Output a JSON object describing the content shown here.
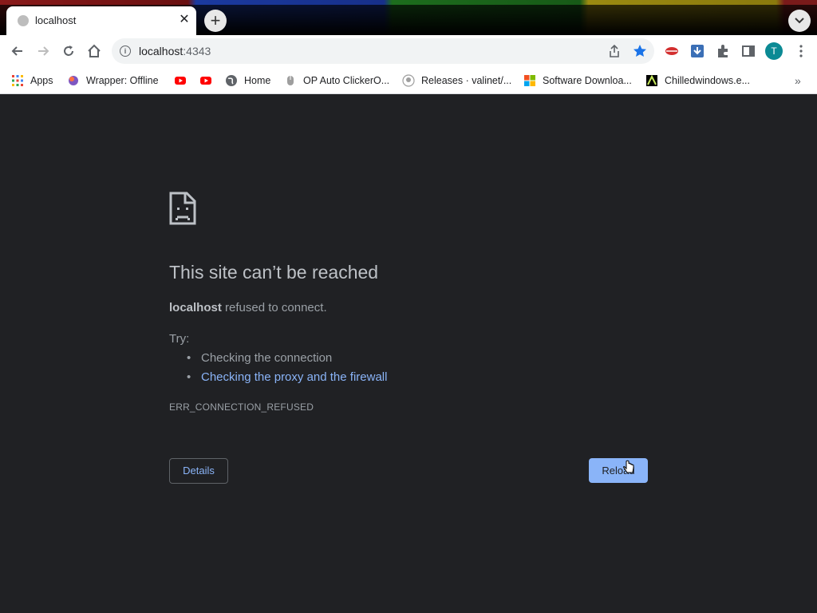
{
  "browser": {
    "tab_title": "localhost",
    "url_host": "localhost",
    "url_port": ":4343",
    "avatar_letter": "T"
  },
  "bookmarks": [
    {
      "label": "Apps",
      "icon": "apps-grid-icon"
    },
    {
      "label": "Wrapper: Offline",
      "icon": "wrapper-icon"
    },
    {
      "label": "",
      "icon": "youtube-icon"
    },
    {
      "label": "",
      "icon": "youtube-icon"
    },
    {
      "label": "Home",
      "icon": "globe-icon"
    },
    {
      "label": "OP Auto ClickerO...",
      "icon": "mouse-icon"
    },
    {
      "label": "Releases · valinet/...",
      "icon": "github-icon"
    },
    {
      "label": "Software Downloa...",
      "icon": "microsoft-icon"
    },
    {
      "label": "Chilledwindows.e...",
      "icon": "chilledwindows-icon"
    }
  ],
  "error_page": {
    "heading": "This site can’t be reached",
    "host": "localhost",
    "message": " refused to connect.",
    "try_label": "Try:",
    "suggestions": [
      "Checking the connection",
      "Checking the proxy and the firewall"
    ],
    "error_code": "ERR_CONNECTION_REFUSED",
    "details_label": "Details",
    "reload_label": "Reload"
  },
  "colors": {
    "page_bg": "#202124",
    "link": "#8ab4f8",
    "text": "#9aa0a6",
    "heading": "#bdc1c6"
  }
}
